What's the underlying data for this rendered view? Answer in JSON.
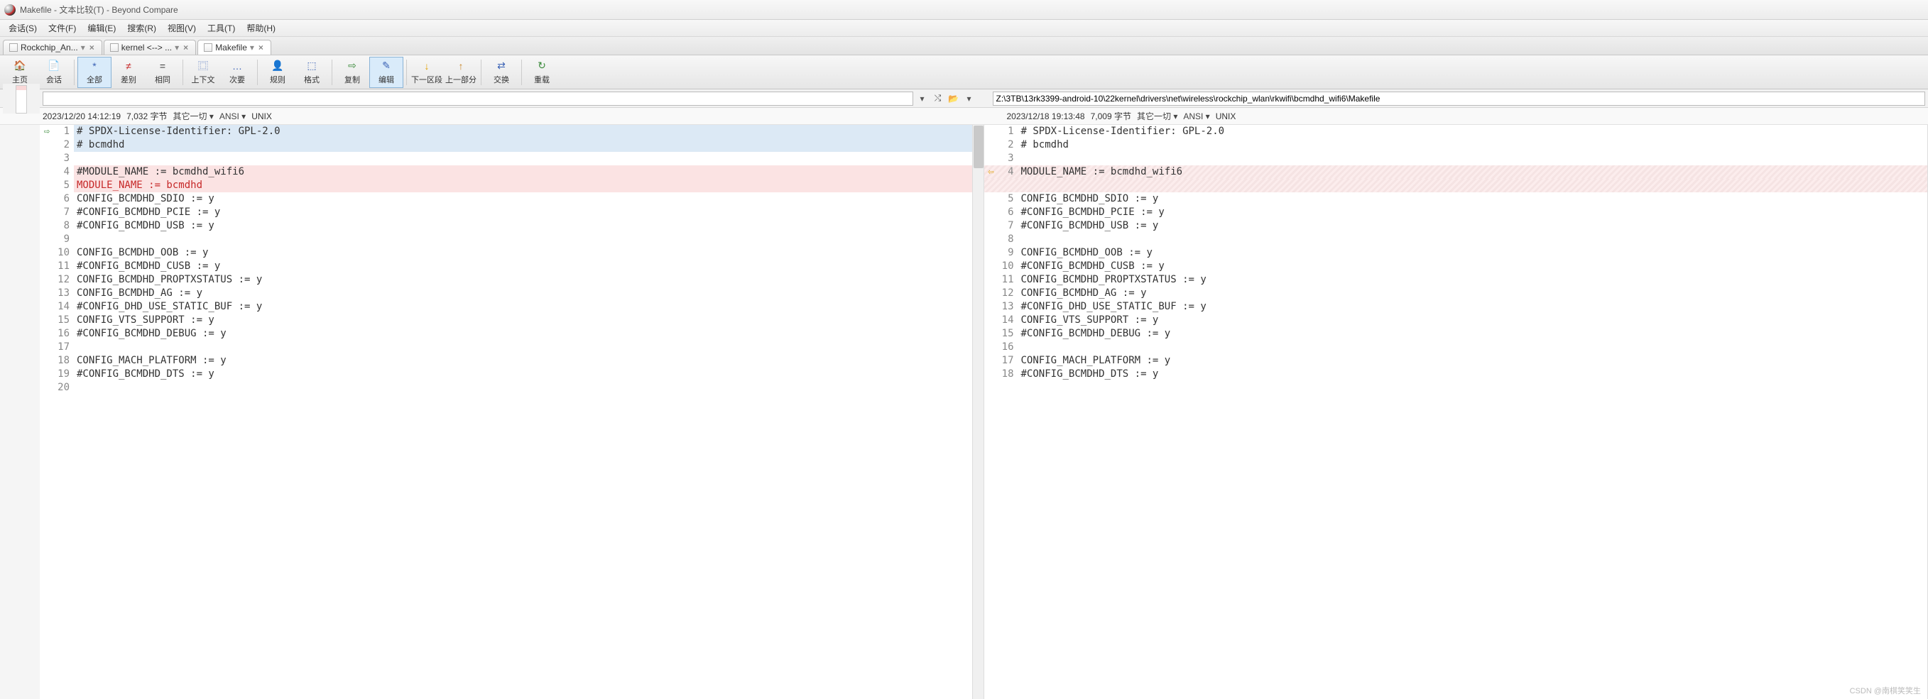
{
  "title": "Makefile - 文本比较(T) - Beyond Compare",
  "menu": [
    "会话(S)",
    "文件(F)",
    "编辑(E)",
    "搜索(R)",
    "视图(V)",
    "工具(T)",
    "帮助(H)"
  ],
  "tabs": [
    {
      "label": "Rockchip_An...",
      "active": false
    },
    {
      "label": "kernel <--> ...",
      "active": false
    },
    {
      "label": "Makefile",
      "active": true
    }
  ],
  "toolbar": [
    {
      "label": "主页",
      "icon": "🏠",
      "color": "#e2a100"
    },
    {
      "label": "会话",
      "icon": "📄",
      "color": "#b07d3a"
    },
    {
      "label": "全部",
      "icon": "*",
      "active": true,
      "color": "#3a62b5"
    },
    {
      "label": "差别",
      "icon": "≠",
      "color": "#c62828"
    },
    {
      "label": "相同",
      "icon": "=",
      "color": "#333"
    },
    {
      "label": "上下文",
      "icon": "⿴",
      "color": "#3a62b5"
    },
    {
      "label": "次要",
      "icon": "…",
      "color": "#3a62b5"
    },
    {
      "label": "规则",
      "icon": "👤",
      "color": "#555"
    },
    {
      "label": "格式",
      "icon": "⬚",
      "color": "#3a62b5"
    },
    {
      "label": "复制",
      "icon": "⇨",
      "color": "#3a8a3a"
    },
    {
      "label": "编辑",
      "icon": "✎",
      "active": true,
      "color": "#3a62b5"
    },
    {
      "label": "下一区段",
      "icon": "↓",
      "color": "#e2a100"
    },
    {
      "label": "上一部分",
      "icon": "↑",
      "color": "#c9862a"
    },
    {
      "label": "交换",
      "icon": "⇄",
      "color": "#3a62b5"
    },
    {
      "label": "重载",
      "icon": "↻",
      "color": "#3a8a3a"
    }
  ],
  "toolbar_seps": [
    2,
    5,
    7,
    9,
    11,
    13,
    14
  ],
  "paths": {
    "left": "",
    "right": "Z:\\3TB\\13rk3399-android-10\\22kernel\\drivers\\net\\wireless\\rockchip_wlan\\rkwifi\\bcmdhd_wifi6\\Makefile"
  },
  "info": {
    "left": {
      "ts": "2023/12/20 14:12:19",
      "size": "7,032 字节",
      "extra": "其它一切 ▾",
      "enc": "ANSI ▾",
      "eol": "UNIX"
    },
    "right": {
      "ts": "2023/12/18 19:13:48",
      "size": "7,009 字节",
      "extra": "其它一切 ▾",
      "enc": "ANSI ▾",
      "eol": "UNIX"
    }
  },
  "left_lines": [
    {
      "n": 1,
      "t": "# SPDX-License-Identifier: GPL-2.0",
      "sel": true,
      "marker": "⇨"
    },
    {
      "n": 2,
      "t": "# bcmdhd",
      "sel": true
    },
    {
      "n": 3,
      "t": ""
    },
    {
      "n": 4,
      "t": "#MODULE_NAME := bcmdhd_wifi6",
      "diff": true
    },
    {
      "n": 5,
      "t": "MODULE_NAME := bcmdhd",
      "diff": true,
      "red": true
    },
    {
      "n": 6,
      "t": "CONFIG_BCMDHD_SDIO := y"
    },
    {
      "n": 7,
      "t": "#CONFIG_BCMDHD_PCIE := y"
    },
    {
      "n": 8,
      "t": "#CONFIG_BCMDHD_USB := y"
    },
    {
      "n": 9,
      "t": ""
    },
    {
      "n": 10,
      "t": "CONFIG_BCMDHD_OOB := y"
    },
    {
      "n": 11,
      "t": "#CONFIG_BCMDHD_CUSB := y"
    },
    {
      "n": 12,
      "t": "CONFIG_BCMDHD_PROPTXSTATUS := y"
    },
    {
      "n": 13,
      "t": "CONFIG_BCMDHD_AG := y"
    },
    {
      "n": 14,
      "t": "#CONFIG_DHD_USE_STATIC_BUF := y"
    },
    {
      "n": 15,
      "t": "CONFIG_VTS_SUPPORT := y"
    },
    {
      "n": 16,
      "t": "#CONFIG_BCMDHD_DEBUG := y"
    },
    {
      "n": 17,
      "t": ""
    },
    {
      "n": 18,
      "t": "CONFIG_MACH_PLATFORM := y"
    },
    {
      "n": 19,
      "t": "#CONFIG_BCMDHD_DTS := y"
    },
    {
      "n": 20,
      "t": ""
    }
  ],
  "right_lines": [
    {
      "n": 1,
      "t": "# SPDX-License-Identifier: GPL-2.0"
    },
    {
      "n": 2,
      "t": "# bcmdhd"
    },
    {
      "n": 3,
      "t": ""
    },
    {
      "n": 4,
      "t": "MODULE_NAME := bcmdhd_wifi6",
      "diff": true,
      "marker": "⇦"
    },
    {
      "n": null,
      "t": "",
      "diff": true
    },
    {
      "n": 5,
      "t": "CONFIG_BCMDHD_SDIO := y"
    },
    {
      "n": 6,
      "t": "#CONFIG_BCMDHD_PCIE := y"
    },
    {
      "n": 7,
      "t": "#CONFIG_BCMDHD_USB := y"
    },
    {
      "n": 8,
      "t": ""
    },
    {
      "n": 9,
      "t": "CONFIG_BCMDHD_OOB := y"
    },
    {
      "n": 10,
      "t": "#CONFIG_BCMDHD_CUSB := y"
    },
    {
      "n": 11,
      "t": "CONFIG_BCMDHD_PROPTXSTATUS := y"
    },
    {
      "n": 12,
      "t": "CONFIG_BCMDHD_AG := y"
    },
    {
      "n": 13,
      "t": "#CONFIG_DHD_USE_STATIC_BUF := y"
    },
    {
      "n": 14,
      "t": "CONFIG_VTS_SUPPORT := y"
    },
    {
      "n": 15,
      "t": "#CONFIG_BCMDHD_DEBUG := y"
    },
    {
      "n": 16,
      "t": ""
    },
    {
      "n": 17,
      "t": "CONFIG_MACH_PLATFORM := y"
    },
    {
      "n": 18,
      "t": "#CONFIG_BCMDHD_DTS := y"
    }
  ],
  "watermark": "CSDN @南棋笑笑生"
}
